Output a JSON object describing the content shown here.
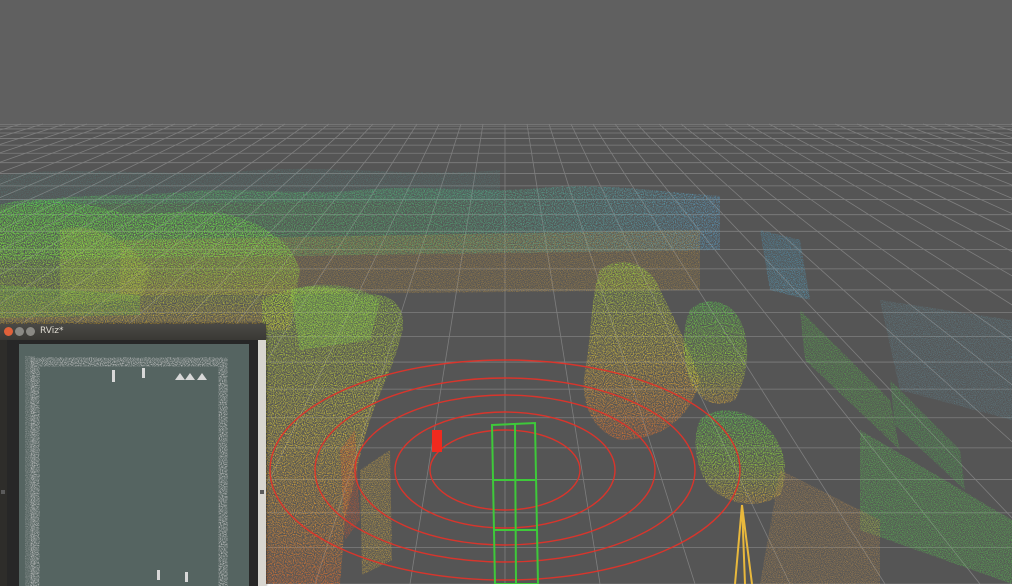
{
  "inset": {
    "title": "RViz*"
  },
  "colors": {
    "sky": "#5f5f5f",
    "ground": "#555555",
    "grid": "#8c8c8c",
    "lidar_rings": "#e0342a",
    "vehicle_box": "#3ec93a",
    "map_floor": "#556461",
    "map_walls": "#c9c9c9"
  },
  "icons": {
    "close": "window-close-icon",
    "minimize": "window-minimize-icon",
    "maximize": "window-maximize-icon"
  }
}
